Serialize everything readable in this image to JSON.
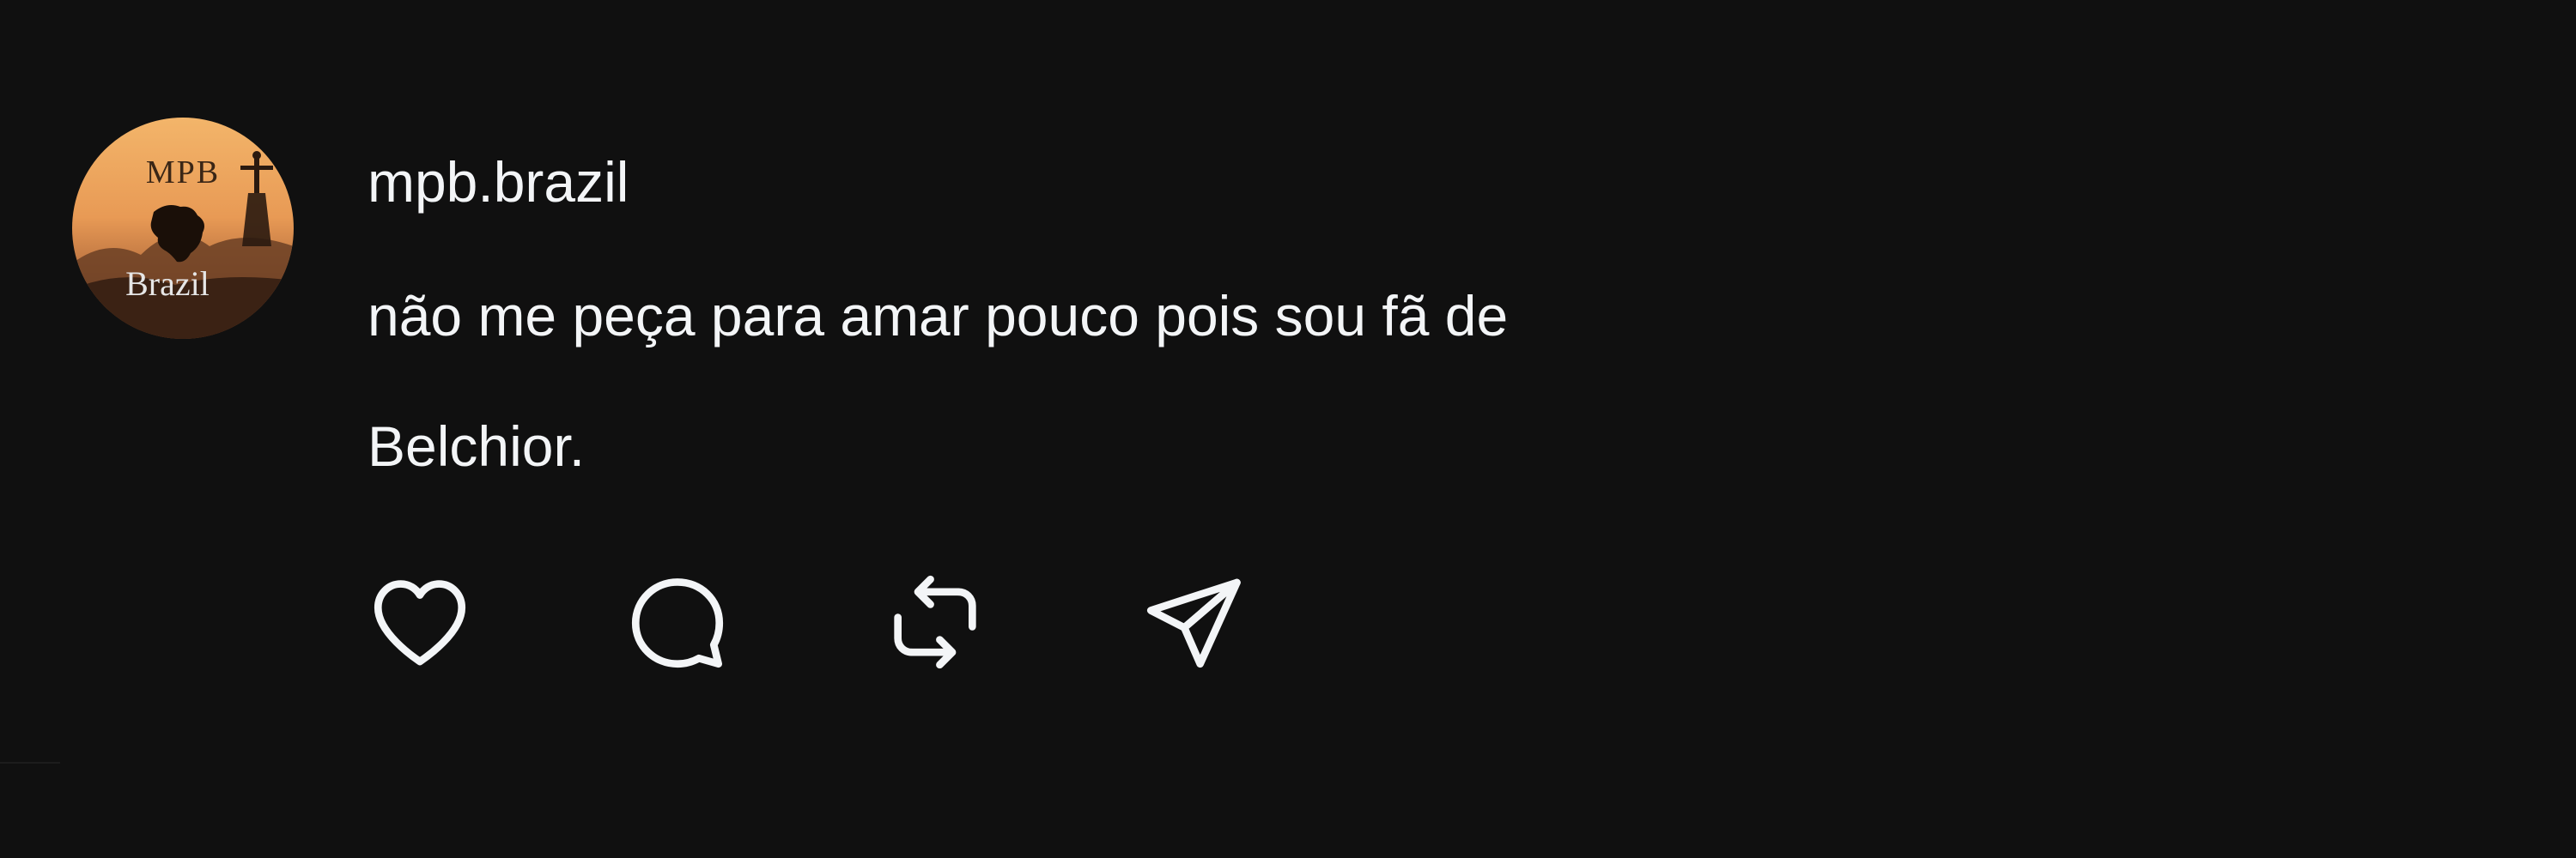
{
  "post": {
    "username": "mpb.brazil",
    "caption_lines": [
      "não me peça para amar pouco pois sou fã de",
      "Belchior."
    ],
    "avatar": {
      "text_top": "MPB",
      "text_bottom": "Brazil",
      "icons": [
        "brazil-map-icon",
        "christ-redeemer-icon"
      ]
    }
  },
  "actions": [
    {
      "name": "like",
      "icon": "heart-icon"
    },
    {
      "name": "comment",
      "icon": "speech-bubble-icon"
    },
    {
      "name": "repost",
      "icon": "repost-icon"
    },
    {
      "name": "share",
      "icon": "paper-plane-icon"
    }
  ],
  "colors": {
    "background": "#101010",
    "text": "#f3f5f7",
    "icon": "#f3f5f7",
    "avatar_sunset_light": "#f0a860",
    "avatar_sunset_dark": "#7a4a2a"
  }
}
